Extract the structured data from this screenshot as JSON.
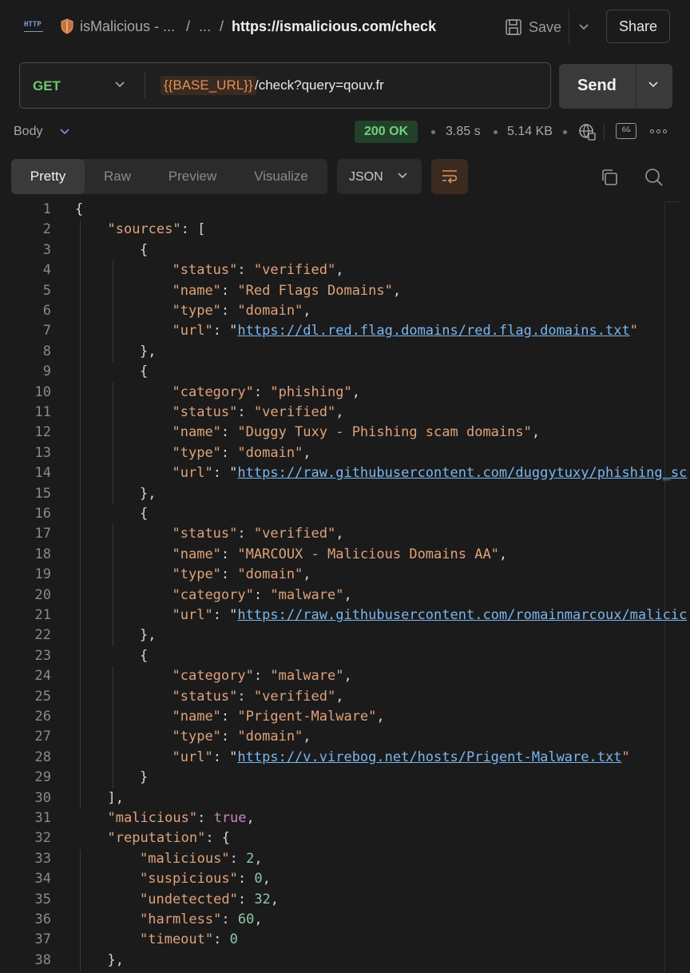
{
  "breadcrumb": {
    "collection": "isMalicious - ...",
    "ellipsis": "...",
    "sep1": "/",
    "sep2": "/",
    "current": "https://ismalicious.com/check"
  },
  "toolbar": {
    "save_label": "Save",
    "share_label": "Share"
  },
  "request": {
    "method": "GET",
    "url_variable": "{{BASE_URL}}",
    "url_path": "/check?query=qouv.fr",
    "send_label": "Send"
  },
  "response_meta": {
    "body_label": "Body",
    "status": "200 OK",
    "time": "3.85 s",
    "size": "5.14 KB"
  },
  "view_tabs": [
    {
      "label": "Pretty",
      "active": true
    },
    {
      "label": "Raw",
      "active": false
    },
    {
      "label": "Preview",
      "active": false
    },
    {
      "label": "Visualize",
      "active": false
    }
  ],
  "format": "JSON",
  "code_lines": [
    [
      [
        "p",
        "{"
      ]
    ],
    [
      [
        "k",
        "\"sources\""
      ],
      [
        "p",
        ": ["
      ]
    ],
    [
      [
        "p",
        "{"
      ]
    ],
    [
      [
        "k",
        "\"status\""
      ],
      [
        "p",
        ": "
      ],
      [
        "s",
        "\"verified\""
      ],
      [
        "p",
        ","
      ]
    ],
    [
      [
        "k",
        "\"name\""
      ],
      [
        "p",
        ": "
      ],
      [
        "s",
        "\"Red Flags Domains\""
      ],
      [
        "p",
        ","
      ]
    ],
    [
      [
        "k",
        "\"type\""
      ],
      [
        "p",
        ": "
      ],
      [
        "s",
        "\"domain\""
      ],
      [
        "p",
        ","
      ]
    ],
    [
      [
        "k",
        "\"url\""
      ],
      [
        "p",
        ": \""
      ],
      [
        "u",
        "https://dl.red.flag.domains/red.flag.domains.txt"
      ],
      [
        "s",
        "\""
      ]
    ],
    [
      [
        "p",
        "},"
      ]
    ],
    [
      [
        "p",
        "{"
      ]
    ],
    [
      [
        "k",
        "\"category\""
      ],
      [
        "p",
        ": "
      ],
      [
        "s",
        "\"phishing\""
      ],
      [
        "p",
        ","
      ]
    ],
    [
      [
        "k",
        "\"status\""
      ],
      [
        "p",
        ": "
      ],
      [
        "s",
        "\"verified\""
      ],
      [
        "p",
        ","
      ]
    ],
    [
      [
        "k",
        "\"name\""
      ],
      [
        "p",
        ": "
      ],
      [
        "s",
        "\"Duggy Tuxy - Phishing scam domains\""
      ],
      [
        "p",
        ","
      ]
    ],
    [
      [
        "k",
        "\"type\""
      ],
      [
        "p",
        ": "
      ],
      [
        "s",
        "\"domain\""
      ],
      [
        "p",
        ","
      ]
    ],
    [
      [
        "k",
        "\"url\""
      ],
      [
        "p",
        ": \""
      ],
      [
        "u",
        "https://raw.githubusercontent.com/duggytuxy/phishing_sc"
      ]
    ],
    [
      [
        "p",
        "},"
      ]
    ],
    [
      [
        "p",
        "{"
      ]
    ],
    [
      [
        "k",
        "\"status\""
      ],
      [
        "p",
        ": "
      ],
      [
        "s",
        "\"verified\""
      ],
      [
        "p",
        ","
      ]
    ],
    [
      [
        "k",
        "\"name\""
      ],
      [
        "p",
        ": "
      ],
      [
        "s",
        "\"MARCOUX - Malicious Domains AA\""
      ],
      [
        "p",
        ","
      ]
    ],
    [
      [
        "k",
        "\"type\""
      ],
      [
        "p",
        ": "
      ],
      [
        "s",
        "\"domain\""
      ],
      [
        "p",
        ","
      ]
    ],
    [
      [
        "k",
        "\"category\""
      ],
      [
        "p",
        ": "
      ],
      [
        "s",
        "\"malware\""
      ],
      [
        "p",
        ","
      ]
    ],
    [
      [
        "k",
        "\"url\""
      ],
      [
        "p",
        ": \""
      ],
      [
        "u",
        "https://raw.githubusercontent.com/romainmarcoux/malicic"
      ]
    ],
    [
      [
        "p",
        "},"
      ]
    ],
    [
      [
        "p",
        "{"
      ]
    ],
    [
      [
        "k",
        "\"category\""
      ],
      [
        "p",
        ": "
      ],
      [
        "s",
        "\"malware\""
      ],
      [
        "p",
        ","
      ]
    ],
    [
      [
        "k",
        "\"status\""
      ],
      [
        "p",
        ": "
      ],
      [
        "s",
        "\"verified\""
      ],
      [
        "p",
        ","
      ]
    ],
    [
      [
        "k",
        "\"name\""
      ],
      [
        "p",
        ": "
      ],
      [
        "s",
        "\"Prigent-Malware\""
      ],
      [
        "p",
        ","
      ]
    ],
    [
      [
        "k",
        "\"type\""
      ],
      [
        "p",
        ": "
      ],
      [
        "s",
        "\"domain\""
      ],
      [
        "p",
        ","
      ]
    ],
    [
      [
        "k",
        "\"url\""
      ],
      [
        "p",
        ": \""
      ],
      [
        "u",
        "https://v.virebog.net/hosts/Prigent-Malware.txt"
      ],
      [
        "s",
        "\""
      ]
    ],
    [
      [
        "p",
        "}"
      ]
    ],
    [
      [
        "p",
        "],"
      ]
    ],
    [
      [
        "k",
        "\"malicious\""
      ],
      [
        "p",
        ": "
      ],
      [
        "b",
        "true"
      ],
      [
        "p",
        ","
      ]
    ],
    [
      [
        "k",
        "\"reputation\""
      ],
      [
        "p",
        ": {"
      ]
    ],
    [
      [
        "k",
        "\"malicious\""
      ],
      [
        "p",
        ": "
      ],
      [
        "n",
        "2"
      ],
      [
        "p",
        ","
      ]
    ],
    [
      [
        "k",
        "\"suspicious\""
      ],
      [
        "p",
        ": "
      ],
      [
        "n",
        "0"
      ],
      [
        "p",
        ","
      ]
    ],
    [
      [
        "k",
        "\"undetected\""
      ],
      [
        "p",
        ": "
      ],
      [
        "n",
        "32"
      ],
      [
        "p",
        ","
      ]
    ],
    [
      [
        "k",
        "\"harmless\""
      ],
      [
        "p",
        ": "
      ],
      [
        "n",
        "60"
      ],
      [
        "p",
        ","
      ]
    ],
    [
      [
        "k",
        "\"timeout\""
      ],
      [
        "p",
        ": "
      ],
      [
        "n",
        "0"
      ]
    ],
    [
      [
        "p",
        "},"
      ]
    ]
  ]
}
